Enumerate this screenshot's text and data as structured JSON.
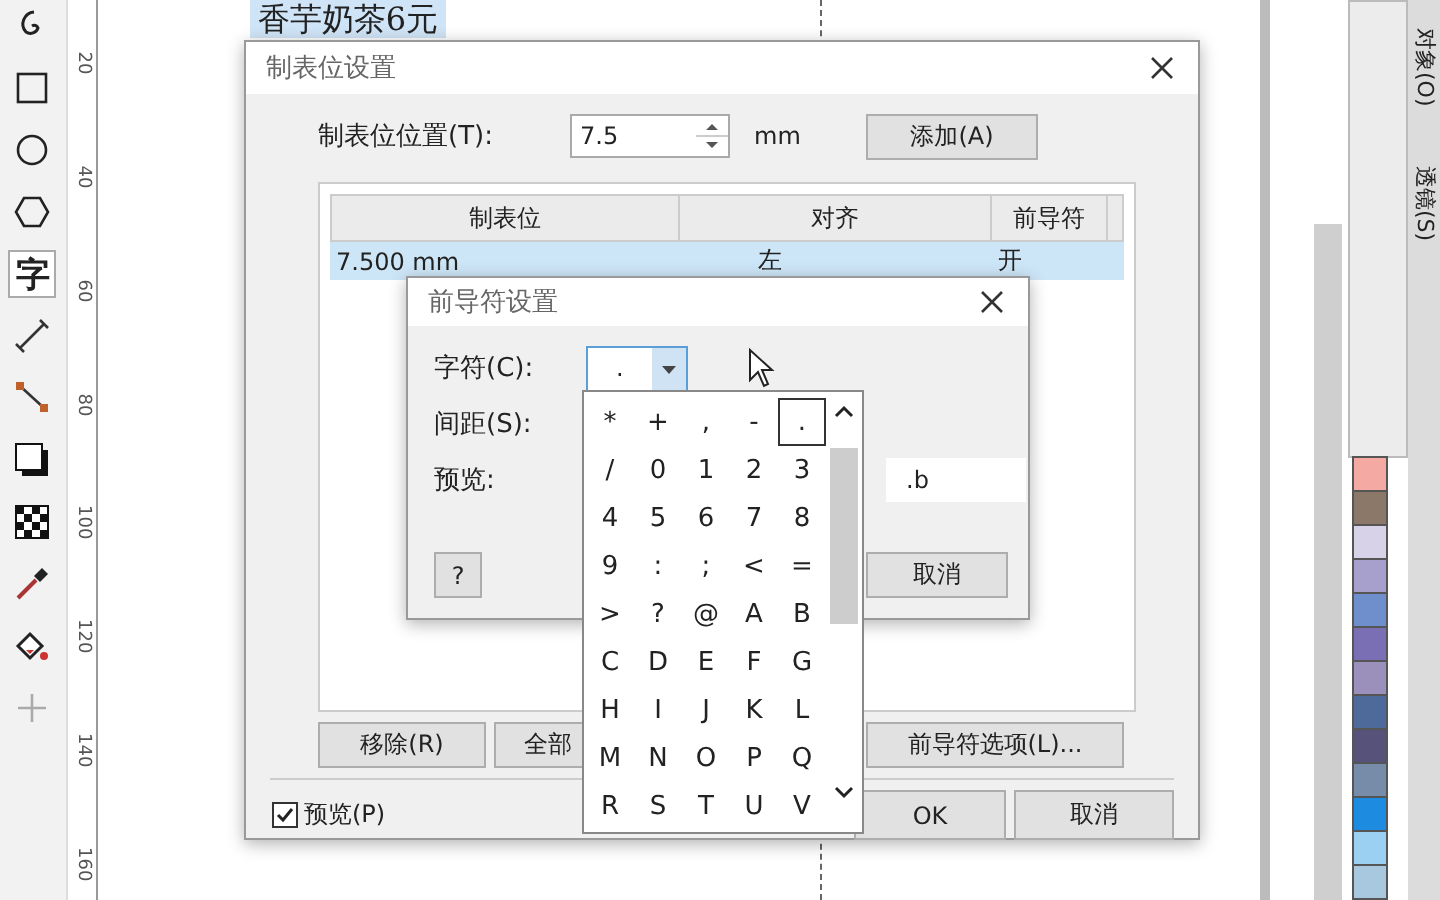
{
  "toolbar": {
    "tools": [
      {
        "kind": "spiral",
        "selected": false
      },
      {
        "kind": "rectangle",
        "selected": false
      },
      {
        "kind": "ellipse",
        "selected": false
      },
      {
        "kind": "polygon",
        "selected": false
      },
      {
        "kind": "text",
        "label": "字",
        "selected": true
      },
      {
        "kind": "dimension",
        "selected": false
      },
      {
        "kind": "connector",
        "selected": false
      },
      {
        "kind": "shadow",
        "selected": false
      },
      {
        "kind": "transparency",
        "selected": false
      },
      {
        "kind": "eyedropper",
        "selected": false
      },
      {
        "kind": "fill",
        "selected": false
      },
      {
        "kind": "add",
        "selected": false
      }
    ]
  },
  "ruler": {
    "labels": [
      "20",
      "40",
      "60",
      "80",
      "100",
      "120",
      "140",
      "160"
    ]
  },
  "canvas": {
    "text_line": "香芋奶茶6元"
  },
  "docker_tabs": [
    {
      "label": "对象(O)"
    },
    {
      "label": "透镜(S)"
    }
  ],
  "palette": [
    {
      "color": "#f4aaa2"
    },
    {
      "color": "#8b7868"
    },
    {
      "color": "#d8d2e8"
    },
    {
      "color": "#a7a0cc"
    },
    {
      "color": "#6f8fcc"
    },
    {
      "color": "#7a6fb5"
    },
    {
      "color": "#9a90bb"
    },
    {
      "color": "#4d6a9a"
    },
    {
      "color": "#56527a"
    },
    {
      "color": "#778ca8"
    },
    {
      "color": "#1d8ce0"
    },
    {
      "color": "#9bd0f2"
    },
    {
      "color": "#a8c8e0"
    }
  ],
  "tab_dialog": {
    "title": "制表位设置",
    "position_label": "制表位位置(T):",
    "position_value": "7.5",
    "unit": "mm",
    "add_button": "添加(A)",
    "columns": [
      "制表位",
      "对齐",
      "前导符"
    ],
    "rows": [
      {
        "cells": [
          "7.500 mm",
          "左",
          "开"
        ],
        "selected": true
      }
    ],
    "buttons": [
      "移除(R)",
      "全部",
      "前导符选项(L)..."
    ],
    "preview_checkbox": {
      "label": "预览(P)",
      "checked": true
    },
    "ok_button": "OK",
    "cancel_button": "取消"
  },
  "leader_dialog": {
    "title": "前导符设置",
    "char_label": "字符(C):",
    "char_value": ".",
    "spacing_label": "间距(S):",
    "preview_label": "预览:",
    "preview_value": ".b",
    "help_button": "?",
    "cancel_button": "取消"
  },
  "char_list": {
    "items": [
      {
        "char": "*",
        "selected": false
      },
      {
        "char": "+",
        "selected": false
      },
      {
        "char": ",",
        "selected": false
      },
      {
        "char": "-",
        "selected": false
      },
      {
        "char": ".",
        "selected": true
      },
      {
        "char": "/",
        "selected": false
      },
      {
        "char": "0",
        "selected": false
      },
      {
        "char": "1",
        "selected": false
      },
      {
        "char": "2",
        "selected": false
      },
      {
        "char": "3",
        "selected": false
      },
      {
        "char": "4",
        "selected": false
      },
      {
        "char": "5",
        "selected": false
      },
      {
        "char": "6",
        "selected": false
      },
      {
        "char": "7",
        "selected": false
      },
      {
        "char": "8",
        "selected": false
      },
      {
        "char": "9",
        "selected": false
      },
      {
        "char": ":",
        "selected": false
      },
      {
        "char": ";",
        "selected": false
      },
      {
        "char": "<",
        "selected": false
      },
      {
        "char": "=",
        "selected": false
      },
      {
        "char": ">",
        "selected": false
      },
      {
        "char": "?",
        "selected": false
      },
      {
        "char": "@",
        "selected": false
      },
      {
        "char": "A",
        "selected": false
      },
      {
        "char": "B",
        "selected": false
      },
      {
        "char": "C",
        "selected": false
      },
      {
        "char": "D",
        "selected": false
      },
      {
        "char": "E",
        "selected": false
      },
      {
        "char": "F",
        "selected": false
      },
      {
        "char": "G",
        "selected": false
      },
      {
        "char": "H",
        "selected": false
      },
      {
        "char": "I",
        "selected": false
      },
      {
        "char": "J",
        "selected": false
      },
      {
        "char": "K",
        "selected": false
      },
      {
        "char": "L",
        "selected": false
      },
      {
        "char": "M",
        "selected": false
      },
      {
        "char": "N",
        "selected": false
      },
      {
        "char": "O",
        "selected": false
      },
      {
        "char": "P",
        "selected": false
      },
      {
        "char": "Q",
        "selected": false
      },
      {
        "char": "R",
        "selected": false
      },
      {
        "char": "S",
        "selected": false
      },
      {
        "char": "T",
        "selected": false
      },
      {
        "char": "U",
        "selected": false
      },
      {
        "char": "V",
        "selected": false
      }
    ]
  }
}
